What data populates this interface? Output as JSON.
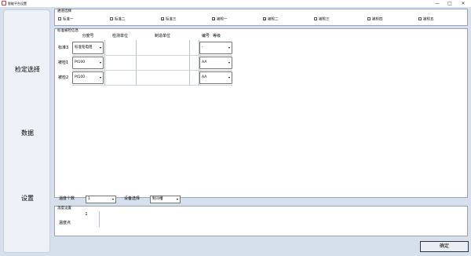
{
  "window": {
    "title": "智能平台设置",
    "minimize": "—",
    "maximize": "□",
    "close": "✕"
  },
  "sidebar": {
    "items": [
      {
        "label": "检定选择"
      },
      {
        "label": "数据"
      },
      {
        "label": "设置"
      }
    ]
  },
  "channel": {
    "title": "通道选择",
    "items": [
      {
        "label": "标准一",
        "checked": false
      },
      {
        "label": "标准二",
        "checked": false
      },
      {
        "label": "标准三",
        "checked": true
      },
      {
        "label": "被检一",
        "checked": true
      },
      {
        "label": "被检二",
        "checked": true
      },
      {
        "label": "被检三",
        "checked": false
      },
      {
        "label": "被检四",
        "checked": false
      },
      {
        "label": "被检五",
        "checked": false
      }
    ]
  },
  "instrument": {
    "title": "标准被检信息",
    "headers": [
      "分度号",
      "检测单位",
      "制造单位",
      "编号",
      "等级"
    ],
    "rows": [
      {
        "label": "标准3",
        "type": "标准铂电阻",
        "grade": "-"
      },
      {
        "label": "被检1",
        "type": "Pt100",
        "grade": "AA"
      },
      {
        "label": "被检2",
        "type": "Pt100",
        "grade": "AA"
      }
    ]
  },
  "controls": {
    "temp_count_label": "温度个数",
    "temp_count_value": "1",
    "device_label": "设备选择",
    "device_value": "制冷槽"
  },
  "temp_settings": {
    "title": "温度设置",
    "column": "1",
    "row_label": "温度点"
  },
  "confirm_label": "确定",
  "icons": {
    "check": "✓",
    "dropdown": "▾"
  }
}
